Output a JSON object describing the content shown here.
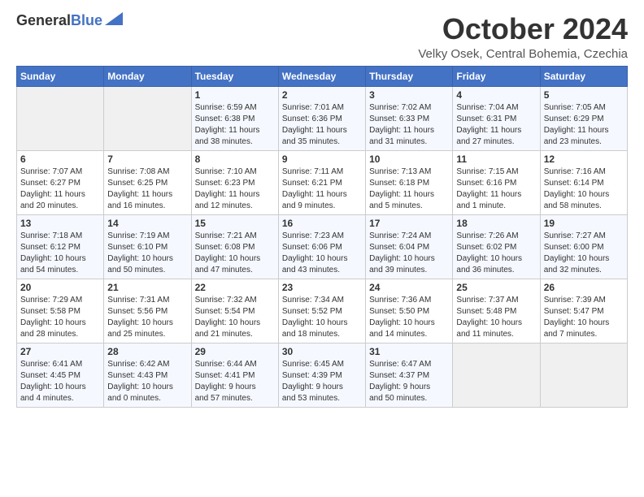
{
  "logo": {
    "general": "General",
    "blue": "Blue"
  },
  "header": {
    "month": "October 2024",
    "location": "Velky Osek, Central Bohemia, Czechia"
  },
  "days_of_week": [
    "Sunday",
    "Monday",
    "Tuesday",
    "Wednesday",
    "Thursday",
    "Friday",
    "Saturday"
  ],
  "weeks": [
    [
      {
        "day": "",
        "info": ""
      },
      {
        "day": "",
        "info": ""
      },
      {
        "day": "1",
        "info": "Sunrise: 6:59 AM\nSunset: 6:38 PM\nDaylight: 11 hours\nand 38 minutes."
      },
      {
        "day": "2",
        "info": "Sunrise: 7:01 AM\nSunset: 6:36 PM\nDaylight: 11 hours\nand 35 minutes."
      },
      {
        "day": "3",
        "info": "Sunrise: 7:02 AM\nSunset: 6:33 PM\nDaylight: 11 hours\nand 31 minutes."
      },
      {
        "day": "4",
        "info": "Sunrise: 7:04 AM\nSunset: 6:31 PM\nDaylight: 11 hours\nand 27 minutes."
      },
      {
        "day": "5",
        "info": "Sunrise: 7:05 AM\nSunset: 6:29 PM\nDaylight: 11 hours\nand 23 minutes."
      }
    ],
    [
      {
        "day": "6",
        "info": "Sunrise: 7:07 AM\nSunset: 6:27 PM\nDaylight: 11 hours\nand 20 minutes."
      },
      {
        "day": "7",
        "info": "Sunrise: 7:08 AM\nSunset: 6:25 PM\nDaylight: 11 hours\nand 16 minutes."
      },
      {
        "day": "8",
        "info": "Sunrise: 7:10 AM\nSunset: 6:23 PM\nDaylight: 11 hours\nand 12 minutes."
      },
      {
        "day": "9",
        "info": "Sunrise: 7:11 AM\nSunset: 6:21 PM\nDaylight: 11 hours\nand 9 minutes."
      },
      {
        "day": "10",
        "info": "Sunrise: 7:13 AM\nSunset: 6:18 PM\nDaylight: 11 hours\nand 5 minutes."
      },
      {
        "day": "11",
        "info": "Sunrise: 7:15 AM\nSunset: 6:16 PM\nDaylight: 11 hours\nand 1 minute."
      },
      {
        "day": "12",
        "info": "Sunrise: 7:16 AM\nSunset: 6:14 PM\nDaylight: 10 hours\nand 58 minutes."
      }
    ],
    [
      {
        "day": "13",
        "info": "Sunrise: 7:18 AM\nSunset: 6:12 PM\nDaylight: 10 hours\nand 54 minutes."
      },
      {
        "day": "14",
        "info": "Sunrise: 7:19 AM\nSunset: 6:10 PM\nDaylight: 10 hours\nand 50 minutes."
      },
      {
        "day": "15",
        "info": "Sunrise: 7:21 AM\nSunset: 6:08 PM\nDaylight: 10 hours\nand 47 minutes."
      },
      {
        "day": "16",
        "info": "Sunrise: 7:23 AM\nSunset: 6:06 PM\nDaylight: 10 hours\nand 43 minutes."
      },
      {
        "day": "17",
        "info": "Sunrise: 7:24 AM\nSunset: 6:04 PM\nDaylight: 10 hours\nand 39 minutes."
      },
      {
        "day": "18",
        "info": "Sunrise: 7:26 AM\nSunset: 6:02 PM\nDaylight: 10 hours\nand 36 minutes."
      },
      {
        "day": "19",
        "info": "Sunrise: 7:27 AM\nSunset: 6:00 PM\nDaylight: 10 hours\nand 32 minutes."
      }
    ],
    [
      {
        "day": "20",
        "info": "Sunrise: 7:29 AM\nSunset: 5:58 PM\nDaylight: 10 hours\nand 28 minutes."
      },
      {
        "day": "21",
        "info": "Sunrise: 7:31 AM\nSunset: 5:56 PM\nDaylight: 10 hours\nand 25 minutes."
      },
      {
        "day": "22",
        "info": "Sunrise: 7:32 AM\nSunset: 5:54 PM\nDaylight: 10 hours\nand 21 minutes."
      },
      {
        "day": "23",
        "info": "Sunrise: 7:34 AM\nSunset: 5:52 PM\nDaylight: 10 hours\nand 18 minutes."
      },
      {
        "day": "24",
        "info": "Sunrise: 7:36 AM\nSunset: 5:50 PM\nDaylight: 10 hours\nand 14 minutes."
      },
      {
        "day": "25",
        "info": "Sunrise: 7:37 AM\nSunset: 5:48 PM\nDaylight: 10 hours\nand 11 minutes."
      },
      {
        "day": "26",
        "info": "Sunrise: 7:39 AM\nSunset: 5:47 PM\nDaylight: 10 hours\nand 7 minutes."
      }
    ],
    [
      {
        "day": "27",
        "info": "Sunrise: 6:41 AM\nSunset: 4:45 PM\nDaylight: 10 hours\nand 4 minutes."
      },
      {
        "day": "28",
        "info": "Sunrise: 6:42 AM\nSunset: 4:43 PM\nDaylight: 10 hours\nand 0 minutes."
      },
      {
        "day": "29",
        "info": "Sunrise: 6:44 AM\nSunset: 4:41 PM\nDaylight: 9 hours\nand 57 minutes."
      },
      {
        "day": "30",
        "info": "Sunrise: 6:45 AM\nSunset: 4:39 PM\nDaylight: 9 hours\nand 53 minutes."
      },
      {
        "day": "31",
        "info": "Sunrise: 6:47 AM\nSunset: 4:37 PM\nDaylight: 9 hours\nand 50 minutes."
      },
      {
        "day": "",
        "info": ""
      },
      {
        "day": "",
        "info": ""
      }
    ]
  ]
}
